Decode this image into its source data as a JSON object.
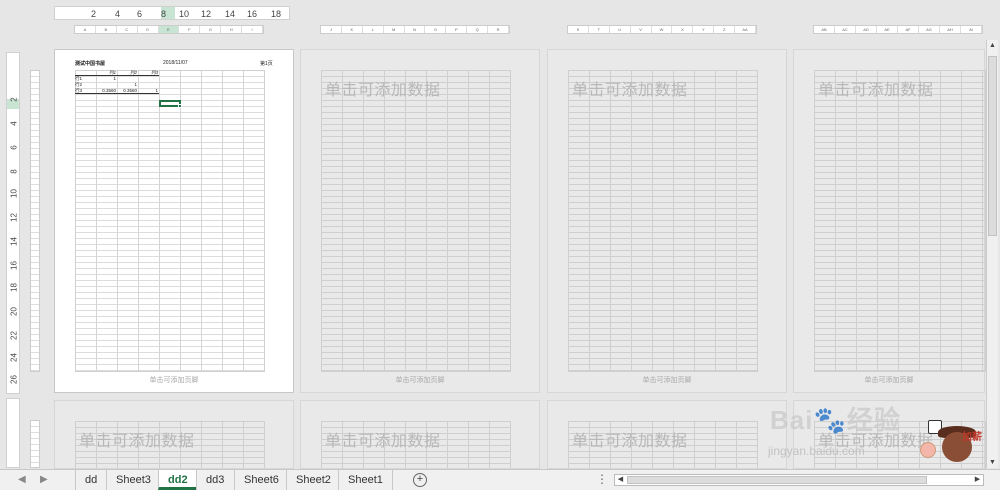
{
  "ruler": {
    "top_ticks": [
      "2",
      "4",
      "6",
      "8",
      "10",
      "12",
      "14",
      "16",
      "18"
    ],
    "side_ticks": [
      "2",
      "4",
      "6",
      "8",
      "10",
      "12",
      "14",
      "16",
      "18",
      "20",
      "22",
      "24",
      "26"
    ]
  },
  "columns": {
    "strip1": [
      "A",
      "B",
      "C",
      "D",
      "E",
      "F",
      "G",
      "H",
      "I"
    ],
    "strip2": [
      "J",
      "K",
      "L",
      "M",
      "N",
      "O",
      "P",
      "Q",
      "R"
    ],
    "strip3": [
      "S",
      "T",
      "U",
      "V",
      "W",
      "X",
      "Y",
      "Z",
      "AA"
    ],
    "strip4": [
      "AB",
      "AC",
      "AD",
      "AE",
      "AF",
      "AG",
      "AH",
      "AI"
    ]
  },
  "active_page": {
    "header_title": "测试中国书屋",
    "header_date": "2018/11/07",
    "header_page": "第1页",
    "table": {
      "header": [
        "",
        "列1",
        "列2",
        "列3"
      ],
      "rows": [
        [
          "行1",
          "1",
          "",
          ""
        ],
        [
          "行2",
          "",
          "1",
          ""
        ],
        [
          "行3",
          "0.3560",
          "0.3560",
          "1"
        ]
      ]
    },
    "footer": "单击可添加页脚"
  },
  "placeholder": {
    "data": "单击可添加数据",
    "footer": "单击可添加页脚"
  },
  "watermark": {
    "brand": "Bai",
    "brand2": "经验",
    "url": "jingyan.baidu.com",
    "badge": "加薪"
  },
  "sheets": {
    "tabs": [
      "dd",
      "Sheet3",
      "dd2",
      "dd3",
      "Sheet6",
      "Sheet2",
      "Sheet1"
    ],
    "active": "dd2",
    "add_symbol": "+"
  }
}
